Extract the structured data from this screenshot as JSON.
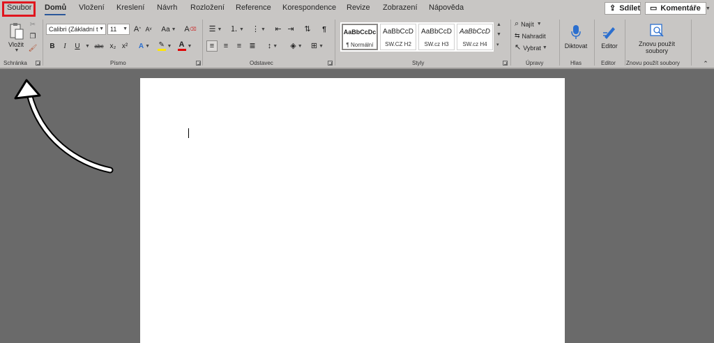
{
  "tabs": [
    "Soubor",
    "Domů",
    "Vložení",
    "Kreslení",
    "Návrh",
    "Rozložení",
    "Reference",
    "Korespondence",
    "Revize",
    "Zobrazení",
    "Nápověda"
  ],
  "header": {
    "share_label": "Sdílet",
    "comments_label": "Komentáře"
  },
  "clipboard": {
    "paste_label": "Vložit",
    "group_label": "Schránka"
  },
  "font": {
    "name": "Calibri (Základní t",
    "size": "11",
    "group_label": "Písmo",
    "bold": "B",
    "italic": "I",
    "underline": "U",
    "strike": "abc",
    "sub": "x₂",
    "sup": "x²",
    "grow": "A",
    "shrink": "A",
    "case": "Aa",
    "clear": "A"
  },
  "paragraph": {
    "group_label": "Odstavec",
    "pilcrow": "¶"
  },
  "styles": {
    "group_label": "Styly",
    "items": [
      {
        "preview": "AaBbCcDc",
        "name": "¶ Normální"
      },
      {
        "preview": "AaBbCcD",
        "name": "SW.CZ H2"
      },
      {
        "preview": "AaBbCcD",
        "name": "SW.cz H3"
      },
      {
        "preview": "AaBbCcD",
        "name": "SW.cz H4"
      }
    ]
  },
  "editing": {
    "find": "Najít",
    "replace": "Nahradit",
    "select": "Vybrat",
    "group_label": "Úpravy"
  },
  "voice": {
    "dictate": "Diktovat",
    "group_label": "Hlas"
  },
  "editor": {
    "label": "Editor",
    "group_label": "Editor"
  },
  "reuse": {
    "label_line1": "Znovu použít",
    "label_line2": "soubory",
    "group_label": "Znovu použít soubory"
  },
  "colors": {
    "accent": "#2b579a",
    "highlight_box": "#e0161e",
    "ribbon": "#c8c6c4",
    "workspace": "#6a6a6a",
    "font_highlight": "#ffe600",
    "font_color": "#e00000"
  }
}
